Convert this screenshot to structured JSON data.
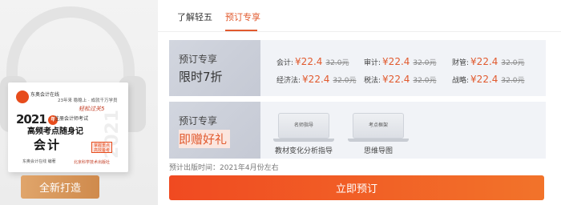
{
  "product": {
    "brand": "东奥会计在线",
    "slogan": "23年来 稳稳上 · 成就千万学员",
    "handwriting": "轻松过关5",
    "year": "2021",
    "year_badge": "年",
    "exam": "注册会计师考试",
    "title1": "高频考点随身记",
    "title2": "会计",
    "tag": "掌握重点 高效备考",
    "ghost_year": "2021",
    "publisher_left": "东奥会计在线  编著",
    "publisher_right": "北京科学技术出版社"
  },
  "left_button": "全新打造",
  "tabs": [
    {
      "label": "了解轻五"
    },
    {
      "label": "预订专享"
    }
  ],
  "promo1": {
    "tag_a": "预订专享",
    "tag_b": "限时7折",
    "items": [
      {
        "label": "会计:",
        "price": "¥22.4",
        "old": "32.0元"
      },
      {
        "label": "审计:",
        "price": "¥22.4",
        "old": "32.0元"
      },
      {
        "label": "财管:",
        "price": "¥22.4",
        "old": "32.0元"
      },
      {
        "label": "经济法:",
        "price": "¥22.4",
        "old": "32.0元"
      },
      {
        "label": "税法:",
        "price": "¥22.4",
        "old": "32.0元"
      },
      {
        "label": "战略:",
        "price": "¥22.4",
        "old": "32.0元"
      }
    ]
  },
  "promo2": {
    "tag_a": "预订专享",
    "tag_b": "即赠好礼",
    "gifts": [
      {
        "screen": "名师指导",
        "caption": "教材变化分析指导"
      },
      {
        "screen": "考点框架",
        "caption": "思维导图"
      }
    ]
  },
  "publish_time": "预计出版时间：2021年4月份左右",
  "main_button": "立即预订",
  "colors": {
    "accent": "#e15a2e",
    "button": "#f04a21",
    "left_button": "#d9975b"
  }
}
